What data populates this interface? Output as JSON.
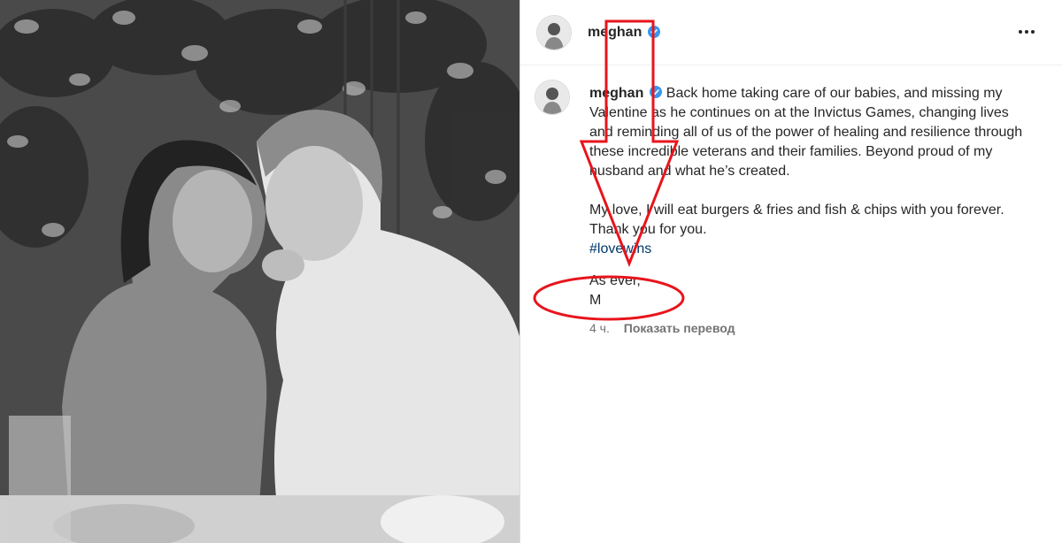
{
  "post": {
    "username": "meghan",
    "caption": {
      "text": "Back home taking care of our babies, and missing my Valentine as he continues on at the Invictus Games, changing lives and reminding all of us of the power of healing and resilience through these incredible veterans and their families. Beyond proud of my husband and what he’s created.",
      "line2": "My love, I will eat burgers & fries and fish & chips with you forever. Thank you for you.",
      "hashtag": "#lovewins",
      "signoff1": "As ever,",
      "signoff2": "M"
    },
    "time": "4 ч.",
    "translate_label": "Показать перевод"
  },
  "colors": {
    "annotation": "#e8141c",
    "hashtag": "#00376b",
    "verified": "#3897f0"
  },
  "icons": {
    "verified": "verified-badge-icon",
    "more": "more-options-icon"
  }
}
